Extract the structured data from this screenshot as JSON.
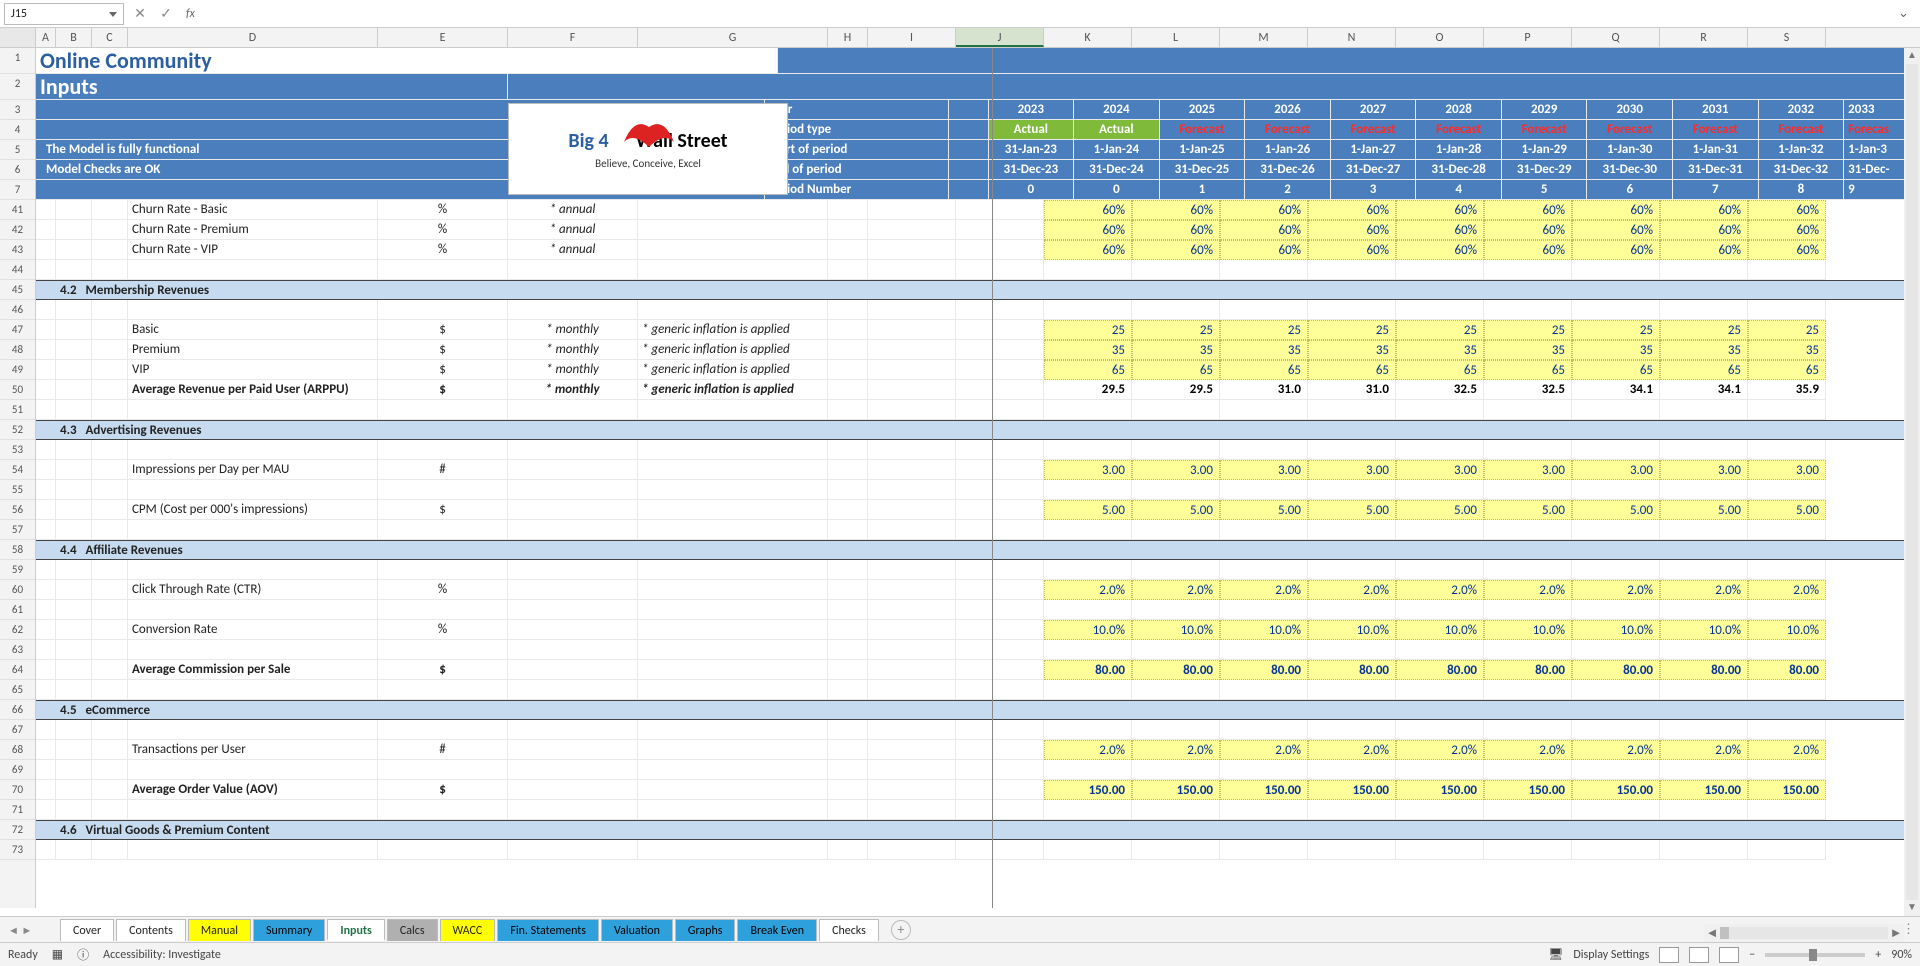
{
  "namebox": "J15",
  "fx": "fx",
  "columns": [
    "A",
    "B",
    "C",
    "D",
    "E",
    "F",
    "G",
    "H",
    "I",
    "J",
    "K",
    "L",
    "M",
    "N",
    "O",
    "P",
    "Q",
    "R",
    "S"
  ],
  "selectedCol": "J",
  "headerRowNums": [
    "1",
    "2",
    "3",
    "4",
    "5",
    "6",
    "7"
  ],
  "title": "Online Community",
  "subtitle": "Inputs",
  "status1": "The Model is fully functional",
  "status2": "Model Checks are OK",
  "logo": {
    "line1a": "Big 4",
    "line1b": "Wall Street",
    "line2": "Believe, Conceive, Excel"
  },
  "hdrLabels": {
    "year": "Year",
    "ptype": "Period type",
    "start": "Start of period",
    "end": "End of period",
    "pnum": "Period Number"
  },
  "years": [
    "2023",
    "2024",
    "2025",
    "2026",
    "2027",
    "2028",
    "2029",
    "2030",
    "2031",
    "2032",
    "2033"
  ],
  "ptypes": [
    "Actual",
    "Actual",
    "Forecast",
    "Forecast",
    "Forecast",
    "Forecast",
    "Forecast",
    "Forecast",
    "Forecast",
    "Forecast",
    "Forecas"
  ],
  "starts": [
    "31-Jan-23",
    "1-Jan-24",
    "1-Jan-25",
    "1-Jan-26",
    "1-Jan-27",
    "1-Jan-28",
    "1-Jan-29",
    "1-Jan-30",
    "1-Jan-31",
    "1-Jan-32",
    "1-Jan-3"
  ],
  "ends": [
    "31-Dec-23",
    "31-Dec-24",
    "31-Dec-25",
    "31-Dec-26",
    "31-Dec-27",
    "31-Dec-28",
    "31-Dec-29",
    "31-Dec-30",
    "31-Dec-31",
    "31-Dec-32",
    "31-Dec-"
  ],
  "pnums": [
    "0",
    "0",
    "1",
    "2",
    "3",
    "4",
    "5",
    "6",
    "7",
    "8",
    "9"
  ],
  "bodyRowNums": [
    "41",
    "42",
    "43",
    "44",
    "45",
    "46",
    "47",
    "48",
    "49",
    "50",
    "51",
    "52",
    "53",
    "54",
    "55",
    "56",
    "57",
    "58",
    "59",
    "60",
    "61",
    "62",
    "63",
    "64",
    "65",
    "66",
    "67",
    "68",
    "69",
    "70",
    "71",
    "72",
    "73"
  ],
  "r41": {
    "label": "Churn Rate - Basic",
    "unit": "%",
    "note": "* annual",
    "vals": [
      "",
      "",
      "60%",
      "60%",
      "60%",
      "60%",
      "60%",
      "60%",
      "60%",
      "60%",
      "60%"
    ]
  },
  "r42": {
    "label": "Churn Rate - Premium",
    "unit": "%",
    "note": "* annual",
    "vals": [
      "",
      "",
      "60%",
      "60%",
      "60%",
      "60%",
      "60%",
      "60%",
      "60%",
      "60%",
      "60%"
    ]
  },
  "r43": {
    "label": "Churn Rate - VIP",
    "unit": "%",
    "note": "* annual",
    "vals": [
      "",
      "",
      "60%",
      "60%",
      "60%",
      "60%",
      "60%",
      "60%",
      "60%",
      "60%",
      "60%"
    ]
  },
  "s42": {
    "num": "4.2",
    "title": "Membership Revenues"
  },
  "r47": {
    "label": "Basic",
    "unit": "$",
    "note": "* monthly",
    "note2": "* generic inflation is applied",
    "vals": [
      "",
      "",
      "25",
      "25",
      "25",
      "25",
      "25",
      "25",
      "25",
      "25",
      "25"
    ]
  },
  "r48": {
    "label": "Premium",
    "unit": "$",
    "note": "* monthly",
    "note2": "* generic inflation is applied",
    "vals": [
      "",
      "",
      "35",
      "35",
      "35",
      "35",
      "35",
      "35",
      "35",
      "35",
      "35"
    ]
  },
  "r49": {
    "label": "VIP",
    "unit": "$",
    "note": "* monthly",
    "note2": "* generic inflation is applied",
    "vals": [
      "",
      "",
      "65",
      "65",
      "65",
      "65",
      "65",
      "65",
      "65",
      "65",
      "65"
    ]
  },
  "r50": {
    "label": "Average Revenue per Paid User (ARPPU)",
    "unit": "$",
    "note": "* monthly",
    "note2": "* generic inflation is applied",
    "vals": [
      "",
      "",
      "29.5",
      "29.5",
      "31.0",
      "31.0",
      "32.5",
      "32.5",
      "34.1",
      "34.1",
      "35.9"
    ]
  },
  "s43": {
    "num": "4.3",
    "title": "Advertising Revenues"
  },
  "r54": {
    "label": "Impressions per Day per MAU",
    "unit": "#",
    "vals": [
      "",
      "",
      "3.00",
      "3.00",
      "3.00",
      "3.00",
      "3.00",
      "3.00",
      "3.00",
      "3.00",
      "3.00"
    ]
  },
  "r56": {
    "label": "CPM (Cost per 000's impressions)",
    "unit": "$",
    "vals": [
      "",
      "",
      "5.00",
      "5.00",
      "5.00",
      "5.00",
      "5.00",
      "5.00",
      "5.00",
      "5.00",
      "5.00"
    ]
  },
  "s44": {
    "num": "4.4",
    "title": "Affiliate Revenues"
  },
  "r60": {
    "label": "Click Through Rate (CTR)",
    "unit": "%",
    "vals": [
      "",
      "",
      "2.0%",
      "2.0%",
      "2.0%",
      "2.0%",
      "2.0%",
      "2.0%",
      "2.0%",
      "2.0%",
      "2.0%"
    ]
  },
  "r62": {
    "label": "Conversion Rate",
    "unit": "%",
    "vals": [
      "",
      "",
      "10.0%",
      "10.0%",
      "10.0%",
      "10.0%",
      "10.0%",
      "10.0%",
      "10.0%",
      "10.0%",
      "10.0%"
    ]
  },
  "r64": {
    "label": "Average Commission per Sale",
    "unit": "$",
    "vals": [
      "",
      "",
      "80.00",
      "80.00",
      "80.00",
      "80.00",
      "80.00",
      "80.00",
      "80.00",
      "80.00",
      "80.00"
    ]
  },
  "s45": {
    "num": "4.5",
    "title": "eCommerce"
  },
  "r68": {
    "label": "Transactions per User",
    "unit": "#",
    "vals": [
      "",
      "",
      "2.0%",
      "2.0%",
      "2.0%",
      "2.0%",
      "2.0%",
      "2.0%",
      "2.0%",
      "2.0%",
      "2.0%"
    ]
  },
  "r70": {
    "label": "Average Order Value (AOV)",
    "unit": "$",
    "vals": [
      "",
      "",
      "150.00",
      "150.00",
      "150.00",
      "150.00",
      "150.00",
      "150.00",
      "150.00",
      "150.00",
      "150.00"
    ]
  },
  "s46": {
    "num": "4.6",
    "title": "Virtual Goods & Premium Content"
  },
  "tabs": [
    "Cover",
    "Contents",
    "Manual",
    "Summary",
    "Inputs",
    "Calcs",
    "WACC",
    "Fin. Statements",
    "Valuation",
    "Graphs",
    "Break Even",
    "Checks"
  ],
  "tabClasses": [
    "",
    "",
    "y",
    "b",
    "inputs active",
    "g",
    "y",
    "b",
    "b",
    "b",
    "b",
    ""
  ],
  "status": {
    "ready": "Ready",
    "acc": "Accessibility: Investigate",
    "disp": "Display Settings",
    "zoom": "90%",
    "zminus": "−",
    "zplus": "+"
  }
}
